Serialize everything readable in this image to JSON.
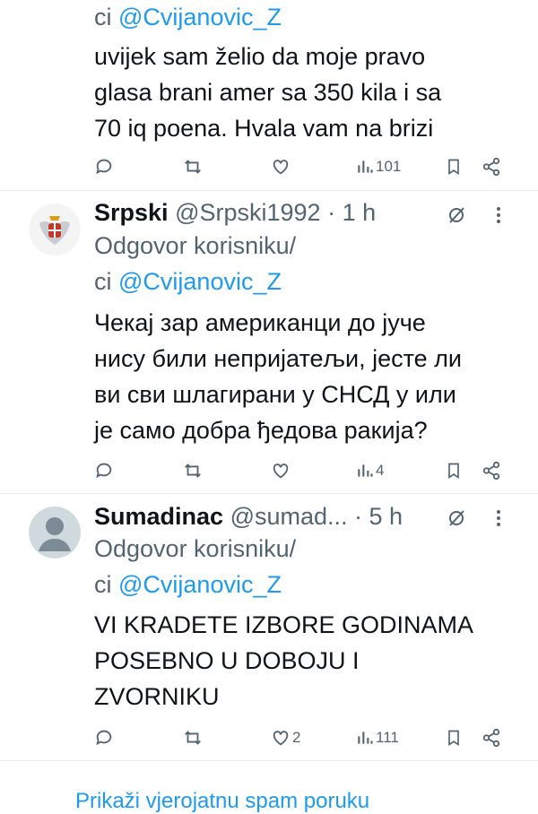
{
  "tweets": [
    {
      "reply_to_prefix": "ci",
      "reply_to_handle": "@Cvijanovic_Z",
      "lines": [
        "uvijek sam želio da moje pravo",
        "glasa brani amer sa 350 kila i sa",
        "70 iq poena. Hvala vam na brizi"
      ],
      "likes": "",
      "views": "101"
    },
    {
      "name": "Srpski",
      "handle": "@Srpski1992",
      "time": "· 1 h",
      "reply_label": "Odgovor korisniku/",
      "reply_to_prefix": "ci",
      "reply_to_handle": "@Cvijanovic_Z",
      "lines": [
        "Чекај зар американци до јуче",
        "нису били непријатељи, јесте ли",
        "ви сви шлагирани у СНСД у или",
        "је само добра ђедова ракија?"
      ],
      "likes": "",
      "views": "4"
    },
    {
      "name": "Sumadinac",
      "handle": "@sumad...",
      "time": "· 5 h",
      "reply_label": "Odgovor korisniku/",
      "reply_to_prefix": "ci",
      "reply_to_handle": "@Cvijanovic_Z",
      "lines": [
        "VI KRADETE IZBORE GODINAMA",
        "POSEBNO U DOBOJU I",
        "ZVORNIKU"
      ],
      "likes": "2",
      "views": "111"
    }
  ],
  "footer": {
    "show_more": "Prikaži vjerojatnu spam poruku"
  },
  "icons": {
    "reply": "reply-icon",
    "retweet": "retweet-icon",
    "like": "heart-icon",
    "views": "views-icon",
    "bookmark": "bookmark-icon",
    "share": "share-icon",
    "grok": "grok-icon",
    "more": "more-icon"
  },
  "colors": {
    "link": "#1d9bf0",
    "muted": "#536471",
    "text": "#0f1419"
  }
}
